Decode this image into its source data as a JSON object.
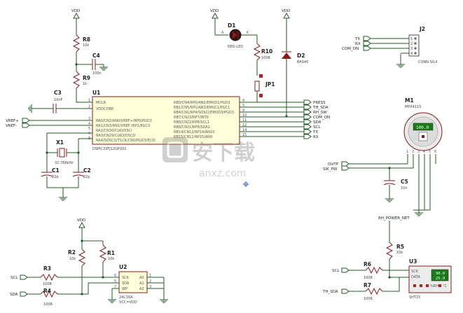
{
  "power": {
    "vdd": "VDD"
  },
  "components": {
    "r8": {
      "ref": "R8",
      "value": "10k"
    },
    "r9": {
      "ref": "R9",
      "value": "1k"
    },
    "c4": {
      "ref": "C4",
      "value": "100n"
    },
    "c3": {
      "ref": "C3",
      "value": "10nF"
    },
    "d1": {
      "ref": "D1",
      "value": "RED-LED",
      "pin_a": "A",
      "pin_k": "K"
    },
    "r10": {
      "ref": "R10",
      "value": "100R"
    },
    "d2": {
      "ref": "D2",
      "value": "BAS40"
    },
    "jp1": {
      "ref": "JP1"
    },
    "u1": {
      "ref": "U1",
      "value": "DSPIC33FJ12GP201"
    },
    "x1": {
      "ref": "X1",
      "value": "32.768kHz"
    },
    "c1": {
      "ref": "C1",
      "value": "22p"
    },
    "c2": {
      "ref": "C2",
      "value": "22p"
    },
    "j2": {
      "ref": "J2",
      "value": "CONN-SIL4"
    },
    "m1": {
      "ref": "M1",
      "value": "MPX4115",
      "display": "100.0"
    },
    "c5": {
      "ref": "C5",
      "value": "10n"
    },
    "r2": {
      "ref": "R2",
      "value": "10k"
    },
    "r1": {
      "ref": "R1",
      "value": "10k"
    },
    "r3": {
      "ref": "R3",
      "value": "100R"
    },
    "r4": {
      "ref": "R4",
      "value": "100R"
    },
    "u2": {
      "ref": "U2",
      "value": "24C16A",
      "note": "VCC=VDD"
    },
    "r5": {
      "ref": "R5",
      "value": "10k"
    },
    "r6": {
      "ref": "R6",
      "value": "100R"
    },
    "r7": {
      "ref": "R7",
      "value": "100R"
    },
    "u3": {
      "ref": "U3",
      "value": "SHT15",
      "display_top": "90.0",
      "display_bottom": "25.0",
      "rh_label": "%RH",
      "c_label": "°C"
    }
  },
  "u1_left_pins": [
    "MCLR",
    "VDDCORE",
    "RA0/CN2/AN0/VREF+/RP0/PGD3",
    "RA1/CN3/AN1/VREF-/RP1/PGC3",
    "RA2/CN30/CLKI/OSCI",
    "RA3/CN29/CLKO/OSCO",
    "RA4/SOSCO/T1CK/CN0/PGD3/ECI0"
  ],
  "u1_left_nums": [
    "1",
    "2",
    "3",
    "4",
    "5",
    "6",
    "8"
  ],
  "u1_right_pins": [
    "RB0/CN4/RP0/AN2/EMUD1/PGD1",
    "RB1/CN5/RP1/AN3/EMUC1/PGC1",
    "RB4/CN1/RP4/SOSCI/EMUD3/PGD3",
    "RB7/CN23/RP7/INT0",
    "RB8/CN22/RP8/SCL1",
    "RB9/CN21/RP9/SDA1",
    "RB14/CN12/RP14/AN10",
    "RB15/CN11/RP15/AN9"
  ],
  "u1_right_nums": [
    "4",
    "5",
    "9",
    "10",
    "11",
    "12",
    "14",
    "15"
  ],
  "u1_nets": [
    "PRESS",
    "TH_SDA",
    "RH_SW",
    "COM_ON",
    "SDA",
    "SCL",
    "TX",
    "RX"
  ],
  "u1_left_nets": [
    "VREF+",
    "VREF-"
  ],
  "j2_nets": [
    "TX",
    "RX",
    "COM_ON"
  ],
  "j2_pins": [
    "1",
    "2",
    "3",
    "4"
  ],
  "m1_pins": [
    "1",
    "2",
    "3",
    "4",
    "5",
    "6"
  ],
  "m1_nets": [
    "OUTP",
    "SIK_PW"
  ],
  "u2_pins_left": [
    "SCK",
    "SDA",
    "WP"
  ],
  "u2_pins_right": [
    "A0",
    "A1",
    "A2"
  ],
  "u2_nums_left": [
    "6",
    "5",
    "7"
  ],
  "u2_nums_right": [
    "1",
    "2",
    "3"
  ],
  "u2_nets": [
    "SCL",
    "SDA"
  ],
  "u3_pins": [
    "SCK",
    "DATA"
  ],
  "u3_nets": [
    "SCL",
    "TH_SDA",
    "RH_POWER_NET"
  ],
  "watermark": {
    "cn": "安下载",
    "en": "anxz.com"
  }
}
